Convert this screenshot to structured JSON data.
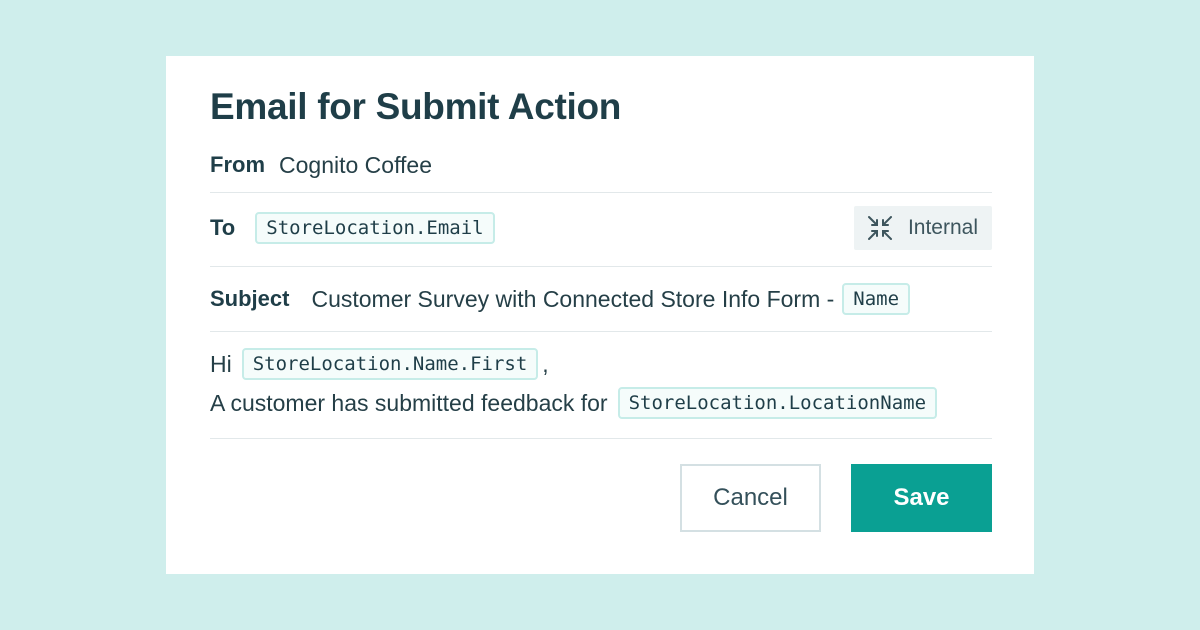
{
  "dialog": {
    "title": "Email for Submit Action"
  },
  "from": {
    "label": "From",
    "value": "Cognito Coffee"
  },
  "to": {
    "label": "To",
    "token": "StoreLocation.Email",
    "badge_label": "Internal",
    "badge_icon": "internal-icon"
  },
  "subject": {
    "label": "Subject",
    "text": "Customer Survey with Connected Store Info Form -",
    "token": "Name"
  },
  "body": {
    "line1_prefix": "Hi",
    "line1_token": "StoreLocation.Name.First",
    "line1_suffix": ",",
    "line2_prefix": "A customer has submitted feedback for",
    "line2_token": "StoreLocation.LocationName"
  },
  "actions": {
    "cancel_label": "Cancel",
    "save_label": "Save"
  },
  "colors": {
    "background": "#cfeeec",
    "accent": "#0aa093",
    "text": "#1f3e48",
    "token_border": "#c6ece8"
  }
}
